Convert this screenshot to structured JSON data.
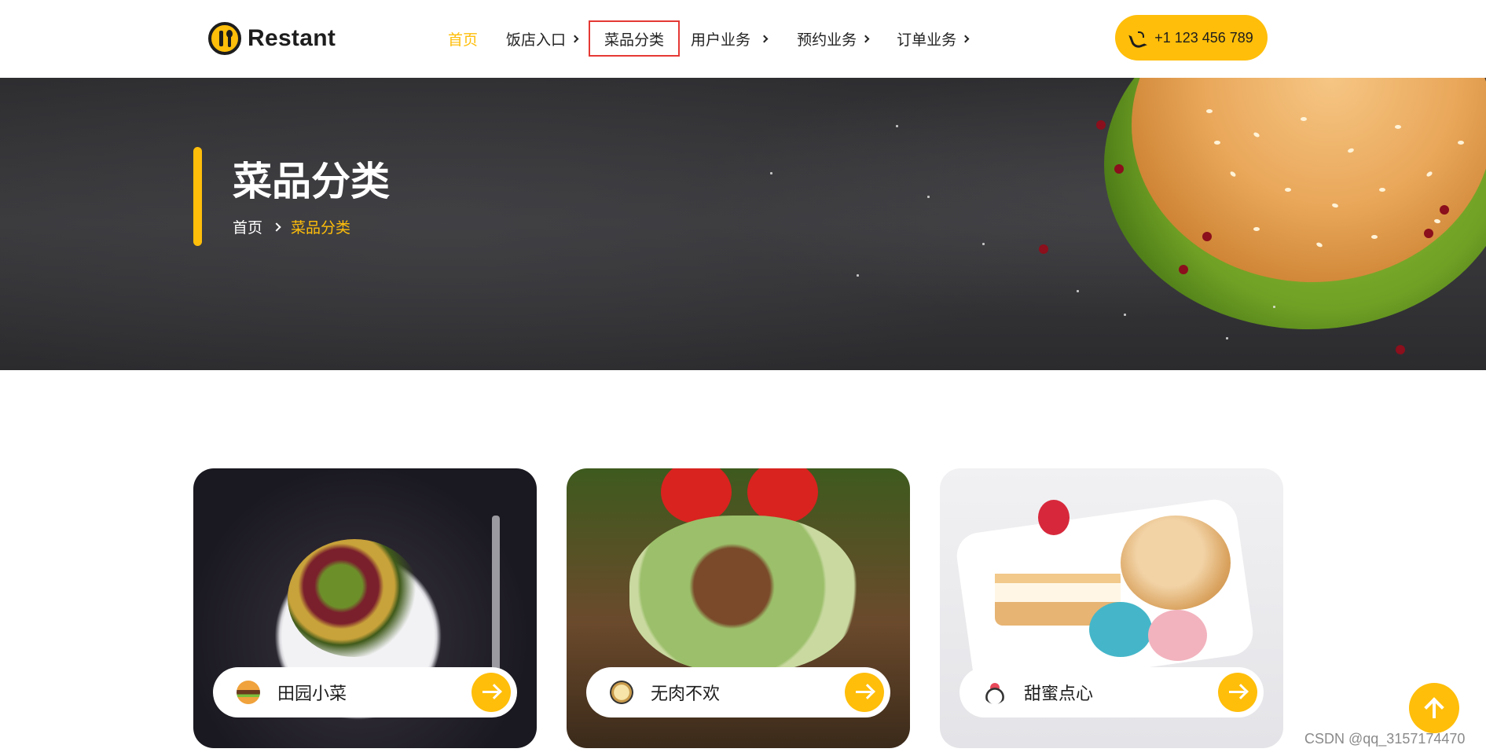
{
  "brand": {
    "name": "Restant"
  },
  "nav": {
    "items": [
      {
        "label": "首页",
        "active": true,
        "has_dropdown": false
      },
      {
        "label": "饭店入口",
        "active": false,
        "has_dropdown": true
      },
      {
        "label": "菜品分类",
        "active": false,
        "has_dropdown": false,
        "highlighted": true
      },
      {
        "label": "用户业务",
        "active": false,
        "has_dropdown": true
      },
      {
        "label": "预约业务",
        "active": false,
        "has_dropdown": true
      },
      {
        "label": "订单业务",
        "active": false,
        "has_dropdown": true
      }
    ]
  },
  "phone": {
    "label": "+1 123 456 789",
    "icon": "phone-icon"
  },
  "hero": {
    "title": "菜品分类",
    "breadcrumb": {
      "home": "首页",
      "current": "菜品分类"
    }
  },
  "categories": [
    {
      "name": "田园小菜",
      "icon": "burger-icon"
    },
    {
      "name": "无肉不欢",
      "icon": "pizza-icon"
    },
    {
      "name": "甜蜜点心",
      "icon": "dessert-icon"
    }
  ],
  "watermark": "CSDN @qq_3157174470",
  "colors": {
    "accent": "#ffbe0a",
    "highlight_border": "#e53935",
    "text": "#1d1d1d"
  }
}
